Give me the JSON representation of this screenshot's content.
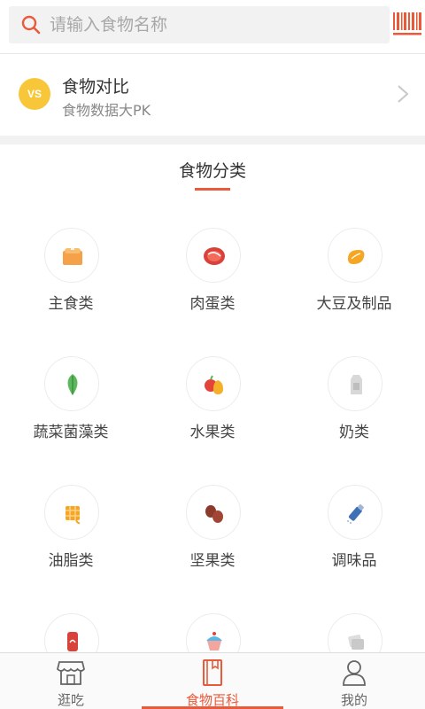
{
  "search": {
    "placeholder": "请输入食物名称",
    "value": ""
  },
  "compare": {
    "badge": "VS",
    "title": "食物对比",
    "subtitle": "食物数据大PK"
  },
  "section": {
    "title": "食物分类"
  },
  "categories": [
    {
      "label": "主食类",
      "icon": "staple-food-icon"
    },
    {
      "label": "肉蛋类",
      "icon": "meat-egg-icon"
    },
    {
      "label": "大豆及制品",
      "icon": "soybean-icon"
    },
    {
      "label": "蔬菜菌藻类",
      "icon": "vegetable-icon"
    },
    {
      "label": "水果类",
      "icon": "fruit-icon"
    },
    {
      "label": "奶类",
      "icon": "milk-icon"
    },
    {
      "label": "油脂类",
      "icon": "oil-fat-icon"
    },
    {
      "label": "坚果类",
      "icon": "nut-icon"
    },
    {
      "label": "调味品",
      "icon": "seasoning-icon"
    },
    {
      "label": "",
      "icon": "drink-icon"
    },
    {
      "label": "",
      "icon": "snack-icon"
    },
    {
      "label": "",
      "icon": "other-food-icon"
    }
  ],
  "tabs": [
    {
      "label": "逛吃",
      "icon": "shop-icon",
      "active": false
    },
    {
      "label": "食物百科",
      "icon": "book-icon",
      "active": true
    },
    {
      "label": "我的",
      "icon": "profile-icon",
      "active": false
    }
  ],
  "colors": {
    "accent": "#e85a3a",
    "vs_badge": "#f8c739",
    "icon_orange": "#f5a14a"
  }
}
